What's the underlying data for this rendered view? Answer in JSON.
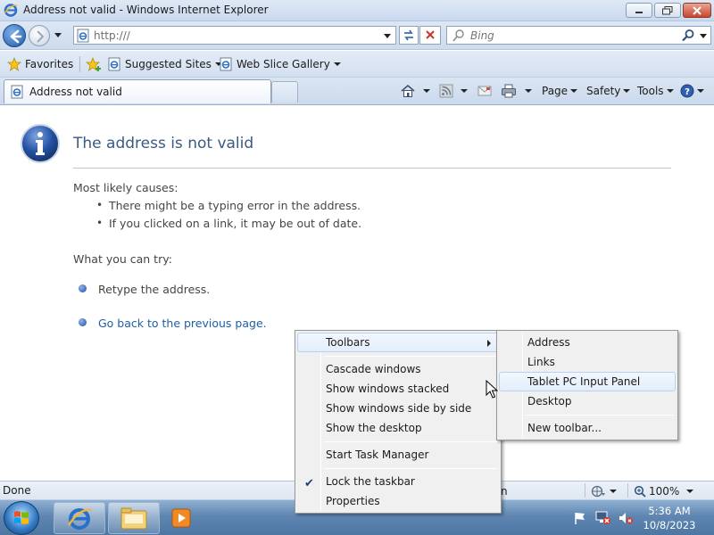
{
  "window": {
    "title": "Address not valid - Windows Internet Explorer"
  },
  "navigation": {
    "address_value": "http:///",
    "search_placeholder": "Bing"
  },
  "favorites_bar": {
    "favorites_label": "Favorites",
    "suggested_sites_label": "Suggested Sites",
    "web_slice_label": "Web Slice Gallery"
  },
  "tab_bar": {
    "active_tab_label": "Address not valid"
  },
  "command_bar": {
    "page_label": "Page",
    "safety_label": "Safety",
    "tools_label": "Tools"
  },
  "content": {
    "heading": "The address is not valid",
    "causes_heading": "Most likely causes:",
    "causes": [
      "There might be a typing error in the address.",
      "If you clicked on a link, it may be out of date."
    ],
    "try_heading": "What you can try:",
    "try_items": [
      "Retype the address.",
      "Go back to the previous page."
    ]
  },
  "status_bar": {
    "status_text": "Done",
    "zoom_label": "100%",
    "partial_zone_text": "n"
  },
  "context_menu": {
    "items": [
      "Toolbars",
      "Cascade windows",
      "Show windows stacked",
      "Show windows side by side",
      "Show the desktop",
      "Start Task Manager",
      "Lock the taskbar",
      "Properties"
    ],
    "checked_item": "Lock the taskbar",
    "highlighted_item": "Toolbars"
  },
  "toolbars_submenu": {
    "items": [
      "Address",
      "Links",
      "Tablet PC Input Panel",
      "Desktop",
      "New toolbar..."
    ],
    "highlighted_item": "Tablet PC Input Panel"
  },
  "taskbar": {
    "clock_time": "5:36 AM",
    "clock_date": "10/8/2023",
    "pinned": [
      "internet-explorer",
      "windows-explorer",
      "media-player"
    ]
  },
  "colors": {
    "heading_blue": "#3a5a80",
    "link_blue": "#1f5fa6",
    "taskbar_blue": "#5f86b1"
  }
}
